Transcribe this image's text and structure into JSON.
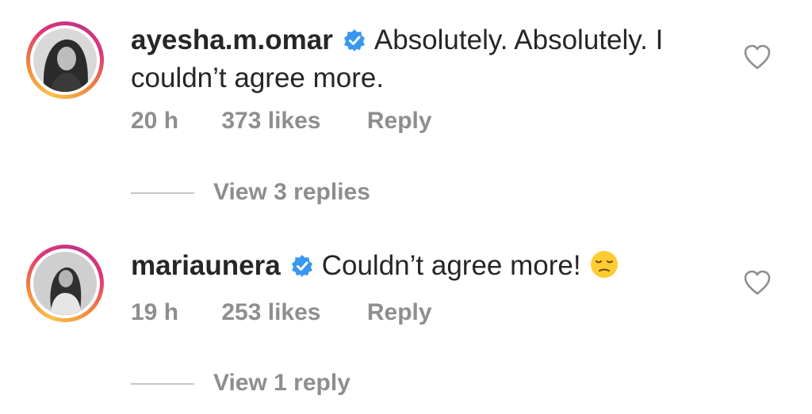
{
  "comments": [
    {
      "username": "ayesha.m.omar",
      "text": "Absolutely. Absolutely. I couldn’t agree more.",
      "time": "20 h",
      "likes": "373 likes",
      "reply_label": "Reply",
      "view_replies": "View 3 replies",
      "verified": true
    },
    {
      "username": "mariaunera",
      "text": "Couldn’t agree more!",
      "emoji": "pensive-face",
      "time": "19 h",
      "likes": "253 likes",
      "reply_label": "Reply",
      "view_replies": "View 1 reply",
      "verified": true
    }
  ],
  "colors": {
    "text": "#262626",
    "meta": "#8e8e8e",
    "verified_blue": "#3897f0",
    "divider": "#c7c7c7"
  }
}
